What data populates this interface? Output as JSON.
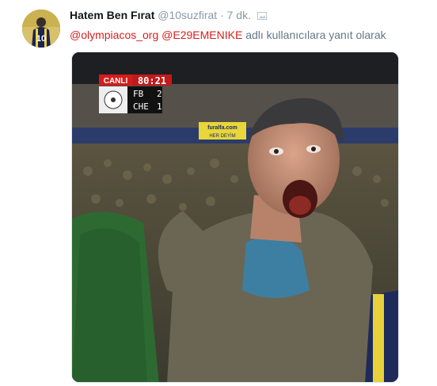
{
  "tweet": {
    "author_name": "Hatem Ben Fırat",
    "handle": "@10suzfirat",
    "separator": "·",
    "time": "7 dk.",
    "reply_prefix": "",
    "mentions": [
      "@olympiacos_org",
      "@E29EMENIKE"
    ],
    "reply_suffix": "adlı kullanıcılara yanıt olarak",
    "avatar_jersey_number": "10",
    "avatar_icon": "avatar-photo",
    "media_indicator_icon": "image-icon"
  },
  "media": {
    "icon": "photo-video-still",
    "broadcast": {
      "live_label": "CANLI",
      "clock": "80:21",
      "scores": [
        {
          "team": "FB",
          "score": "2"
        },
        {
          "team": "CHE",
          "score": "1"
        }
      ],
      "banner_text_1": "furalfa.com",
      "banner_text_2": "HER DEYİM"
    }
  },
  "colors": {
    "mention": "#d81e1e",
    "muted": "#8899a6",
    "live_red": "#d41c1c"
  }
}
